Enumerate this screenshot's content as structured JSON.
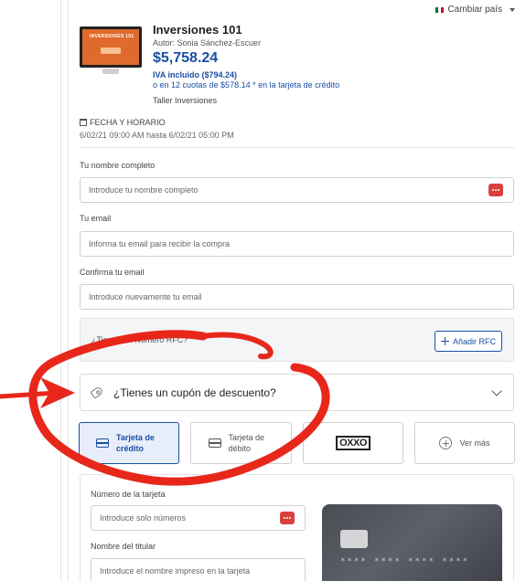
{
  "country_selector": {
    "label": "Cambiar país",
    "flag_colors": [
      "#006847",
      "#ffffff",
      "#ce1126"
    ]
  },
  "product": {
    "title": "Inversiones 101",
    "author": "Autor: Sonia Sánchez-Escuer",
    "price": "$5,758.24",
    "iva": "IVA incluido ($794.24)",
    "installments": "o en 12 cuotas de $578.14 * en la tarjeta de crédito",
    "workshop": "Taller Inversiones",
    "thumbnail_text": "INVERSIONES 101"
  },
  "schedule": {
    "label": "FECHA Y HORARIO",
    "value": "6/02/21 09:00 AM hasta 6/02/21 05:00 PM"
  },
  "form": {
    "name_label": "Tu nombre completo",
    "name_placeholder": "Introduce tu nombre completo",
    "email_label": "Tu email",
    "email_placeholder": "Informa tu email para recibir la compra",
    "confirm_label": "Confirma tu email",
    "confirm_placeholder": "Introduce nuevamente tu email"
  },
  "rfc": {
    "text": "¿Tienes un Número RFC?",
    "button": "Añadir RFC"
  },
  "coupon": {
    "label": "¿Tienes un cupón de descuento?"
  },
  "payment_methods": [
    {
      "label": "Tarjeta de crédito",
      "selected": true
    },
    {
      "label": "Tarjeta de débito",
      "selected": false
    },
    {
      "label": "OXXO",
      "selected": false
    },
    {
      "label": "Ver más",
      "selected": false
    }
  ],
  "card_form": {
    "number_label": "Número de la tarjeta",
    "number_placeholder": "Introduce solo números",
    "holder_label": "Nombre del titular",
    "holder_placeholder": "Introduce el nombre impreso en la tarjeta",
    "preview_number": "**** **** **** ****"
  },
  "annotation": {
    "color": "#e8271b"
  },
  "colors": {
    "accent": "#1a4fa3",
    "danger": "#d9403b"
  }
}
